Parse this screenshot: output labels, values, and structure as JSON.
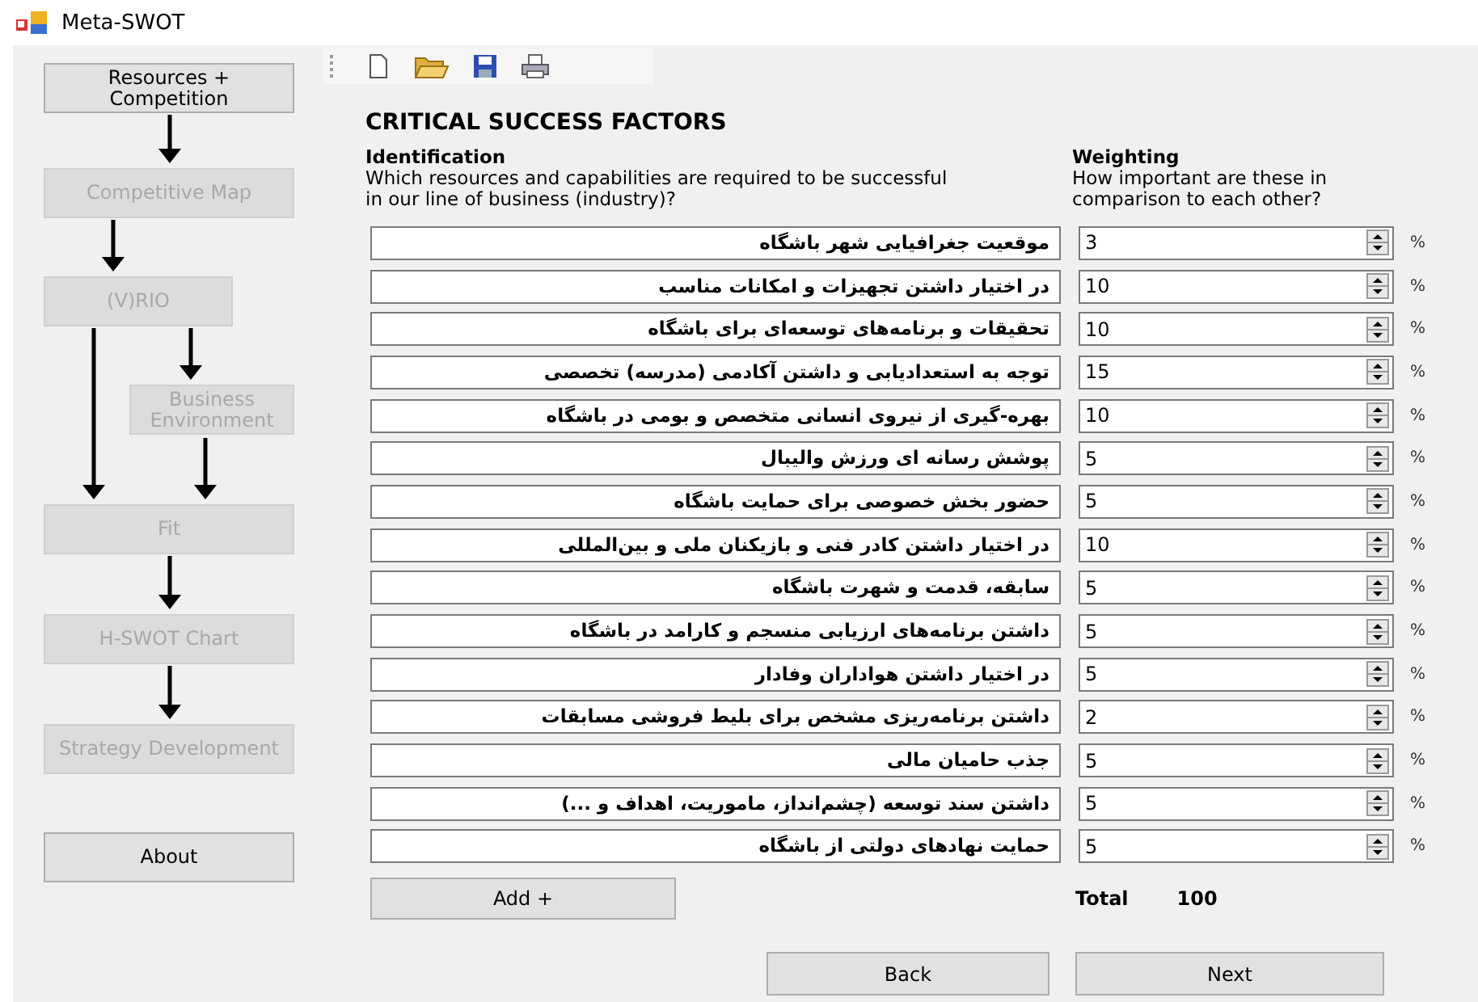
{
  "window": {
    "title": "Meta-SWOT"
  },
  "sidebar": {
    "steps": [
      {
        "label": "Resources + Competition",
        "disabled": false
      },
      {
        "label": "Competitive Map",
        "disabled": true
      },
      {
        "label": "(V)RIO",
        "disabled": true
      },
      {
        "label": "Business Environment",
        "disabled": true
      },
      {
        "label": "Fit",
        "disabled": true
      },
      {
        "label": "H-SWOT Chart",
        "disabled": true
      },
      {
        "label": "Strategy Development",
        "disabled": true
      },
      {
        "label": "About",
        "disabled": false
      }
    ]
  },
  "heading": "CRITICAL SUCCESS FACTORS",
  "identification": {
    "title": "Identification",
    "hint": "Which resources and capabilities are required to be successful in our line of business (industry)?"
  },
  "weighting": {
    "title": "Weighting",
    "hint": "How important are these in comparison to each other?"
  },
  "factors": [
    {
      "name": "موقعیت جغرافیایی شهر باشگاه",
      "weight": "3",
      "unit": "%"
    },
    {
      "name": "در اختیار داشتن تجهیزات و امکانات مناسب",
      "weight": "10",
      "unit": "%"
    },
    {
      "name": "تحقیقات و برنامه‌های توسعه‌ای برای باشگاه",
      "weight": "10",
      "unit": "%"
    },
    {
      "name": "توجه به استعدادیابی و داشتن آکادمی (مدرسه) تخصصی",
      "weight": "15",
      "unit": "%"
    },
    {
      "name": "بهره-گیری از نیروی انسانی متخصص و بومی در باشگاه",
      "weight": "10",
      "unit": "%"
    },
    {
      "name": "پوشش رسانه ای ورزش والیبال",
      "weight": "5",
      "unit": "%"
    },
    {
      "name": "حضور بخش خصوصی برای حمایت باشگاه",
      "weight": "5",
      "unit": "%"
    },
    {
      "name": "در اختیار داشتن کادر فنی و بازیکنان ملی و بین‌المللی",
      "weight": "10",
      "unit": "%"
    },
    {
      "name": "سابقه، قدمت و شهرت باشگاه",
      "weight": "5",
      "unit": "%"
    },
    {
      "name": "داشتن برنامه‌های ارزیابی منسجم و کارامد در باشگاه",
      "weight": "5",
      "unit": "%"
    },
    {
      "name": "در اختیار داشتن هواداران وفادار",
      "weight": "5",
      "unit": "%"
    },
    {
      "name": "داشتن برنامه‌ریزی مشخص برای بلیط فروشی مسابقات",
      "weight": "2",
      "unit": "%"
    },
    {
      "name": "جذب حامیان مالی",
      "weight": "5",
      "unit": "%"
    },
    {
      "name": "داشتن سند توسعه (چشم‌انداز، ماموریت، اهداف و ...)",
      "weight": "5",
      "unit": "%"
    },
    {
      "name": "حمایت نهادهای دولتی از باشگاه",
      "weight": "5",
      "unit": "%"
    }
  ],
  "add_button": "Add +",
  "total": {
    "label": "Total",
    "value": "100"
  },
  "back_button": "Back",
  "next_button": "Next"
}
